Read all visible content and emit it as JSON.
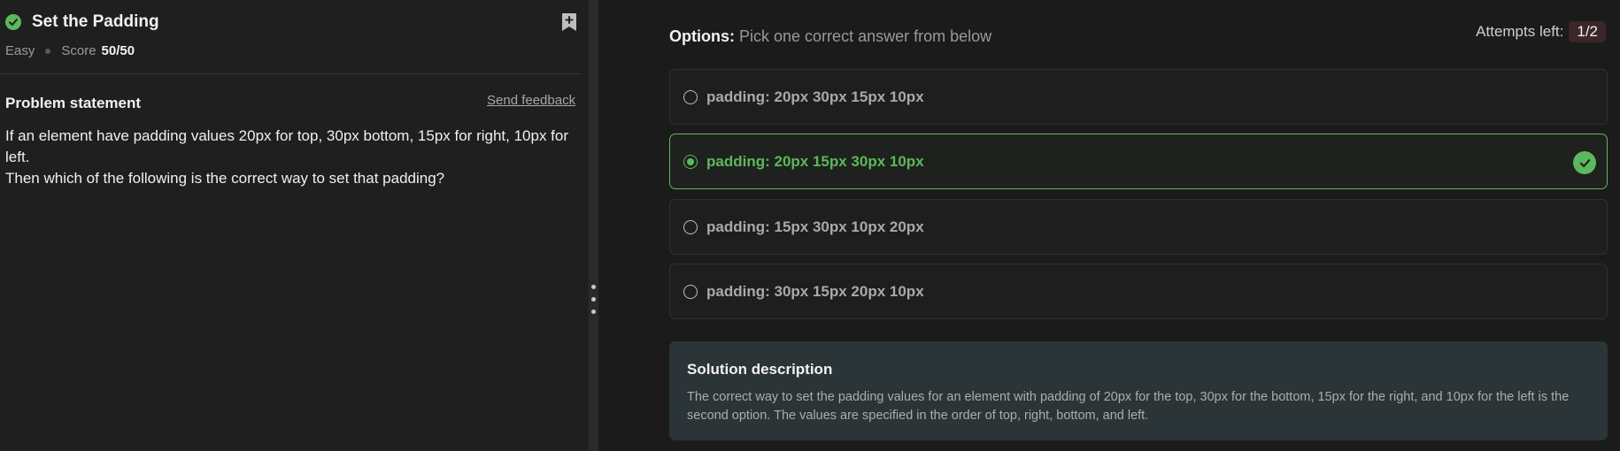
{
  "problem": {
    "title": "Set the Padding",
    "difficulty": "Easy",
    "score_label": "Score",
    "score_value": "50/50",
    "statement_title": "Problem statement",
    "feedback_link": "Send feedback",
    "statement_lines": [
      "If an element have padding values 20px for top, 30px bottom, 15px for right, 10px for left.",
      "Then which of the following is the correct way to set that padding?"
    ]
  },
  "options": {
    "heading_bold": "Options:",
    "heading_text": "Pick one correct answer from below",
    "attempts_label": "Attempts left:",
    "attempts_value": "1/2",
    "items": [
      {
        "label": "padding: 20px 30px 15px 10px",
        "selected": false
      },
      {
        "label": "padding: 20px 15px 30px 10px",
        "selected": true,
        "correct": true
      },
      {
        "label": "padding: 15px 30px 10px 20px",
        "selected": false
      },
      {
        "label": "padding: 30px 15px 20px 10px",
        "selected": false
      }
    ]
  },
  "solution": {
    "title": "Solution description",
    "text": "The correct way to set the padding values for an element with padding of 20px for the top, 30px for the bottom, 15px for the right, and 10px for the left is the second option. The values are specified in the order of top, right, bottom, and left."
  },
  "colors": {
    "success": "#5cb85c",
    "background": "#1b1b1b",
    "solution_bg": "#2b3436",
    "attempts_badge_bg": "#3b2629"
  },
  "icons": [
    "check-circle-icon",
    "bookmark-add-icon",
    "radio-icon",
    "correct-check-icon",
    "drag-handle-icon"
  ]
}
